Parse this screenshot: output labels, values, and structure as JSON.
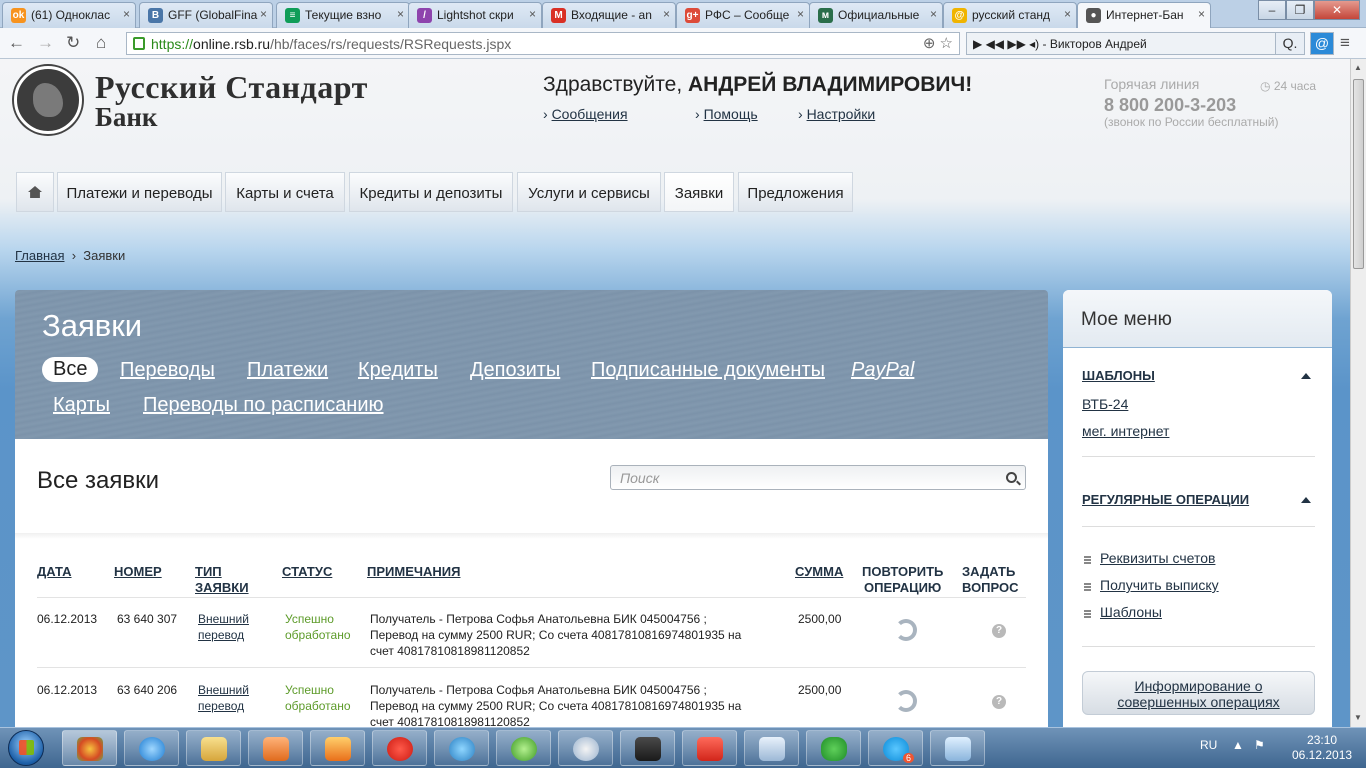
{
  "browser": {
    "tabs": [
      {
        "label": "(61) Одноклас",
        "icon_color": "#f7931e",
        "icon": "odnoklassniki-icon"
      },
      {
        "label": "GFF (GlobalFina",
        "icon_color": "#4a76a8",
        "icon": "vk-icon"
      },
      {
        "label": "Текущие взно",
        "icon_color": "#0f9d58",
        "icon": "sheets-icon"
      },
      {
        "label": "Lightshot скри",
        "icon_color": "#8e44ad",
        "icon": "feather-icon"
      },
      {
        "label": "Входящие - an",
        "icon_color": "#d93025",
        "icon": "gmail-icon"
      },
      {
        "label": "РФС – Сообще",
        "icon_color": "#dd4b39",
        "icon": "gplus-icon"
      },
      {
        "label": "Официальные",
        "icon_color": "#2a6e4a",
        "icon": "mmm-icon"
      },
      {
        "label": "русский станд",
        "icon_color": "#f0b400",
        "icon": "search-engine-icon"
      },
      {
        "label": "Интернет-Бан",
        "icon_color": "#555555",
        "icon": "rsb-icon"
      }
    ],
    "url_https": "https://",
    "url_host": "online.rsb.ru",
    "url_path": "/hb/faces/rs/requests/RSRequests.jspx",
    "ext_text": "◂) - Викторов Андрей",
    "ext_search_label": "Q.",
    "mail_label": "@"
  },
  "header": {
    "brand_line1": "Русский Стандарт",
    "brand_line2": "Банк",
    "greeting_prefix": "Здравствуйте, ",
    "greeting_name": "АНДРЕЙ ВЛАДИМИРОВИЧ!",
    "links": [
      "Сообщения",
      "Помощь",
      "Настройки"
    ],
    "hotline_title": "Горячая линия",
    "hotline_number": "8 800 200-3-203",
    "hotline_note": "(звонок по России бесплатный)",
    "hours": "24 часа"
  },
  "menu": {
    "items": [
      "Платежи и переводы",
      "Карты и счета",
      "Кредиты и депозиты",
      "Услуги и сервисы",
      "Заявки",
      "Предложения"
    ],
    "active": "Заявки"
  },
  "breadcrumb": {
    "home": "Главная",
    "current": "Заявки"
  },
  "requests": {
    "title": "Заявки",
    "filters": [
      "Все",
      "Переводы",
      "Платежи",
      "Кредиты",
      "Депозиты",
      "Подписанные документы",
      "PayPal",
      "Карты",
      "Переводы по расписанию"
    ],
    "selected_filter": "Все",
    "subtitle": "Все заявки",
    "search_placeholder": "Поиск",
    "columns": {
      "date": "ДАТА",
      "number": "НОМЕР",
      "type1": "ТИП",
      "type2": "ЗАЯВКИ",
      "status": "СТАТУС",
      "notes": "ПРИМЕЧАНИЯ",
      "sum": "СУММА",
      "repeat1": "ПОВТОРИТЬ",
      "repeat2": "ОПЕРАЦИЮ",
      "ask1": "ЗАДАТЬ",
      "ask2": "ВОПРОС"
    },
    "rows": [
      {
        "date": "06.12.2013",
        "number": "63 640 307",
        "type1": "Внешний",
        "type2": "перевод",
        "status1": "Успешно",
        "status2": "обработано",
        "note1": "Получатель - Петрова Софья Анатольевна БИК 045004756 ;",
        "note2": "Перевод на сумму 2500 RUR; Со счета 40817810816974801935 на",
        "note3": "счет 40817810818981120852",
        "sum": "2500,00"
      },
      {
        "date": "06.12.2013",
        "number": "63 640 206",
        "type1": "Внешний",
        "type2": "перевод",
        "status1": "Успешно",
        "status2": "обработано",
        "note1": "Получатель - Петрова Софья Анатольевна БИК 045004756 ;",
        "note2": "Перевод на сумму 2500 RUR; Со счета 40817810816974801935 на",
        "note3": "счет 40817810818981120852",
        "sum": "2500,00"
      }
    ]
  },
  "side_menu": {
    "title": "Мое меню",
    "templates_title": "ШАБЛОНЫ",
    "templates": [
      "ВТБ-24",
      "мег. интернет"
    ],
    "regular_title": "РЕГУЛЯРНЫЕ ОПЕРАЦИИ",
    "regular": [
      "Реквизиты счетов",
      "Получить выписку",
      "Шаблоны"
    ],
    "info_button_line1": "Информирование о",
    "info_button_line2": "совершенных операциях"
  },
  "taskbar": {
    "lang": "RU",
    "time": "23:10",
    "date": "06.12.2013",
    "skype_badge": "6"
  }
}
